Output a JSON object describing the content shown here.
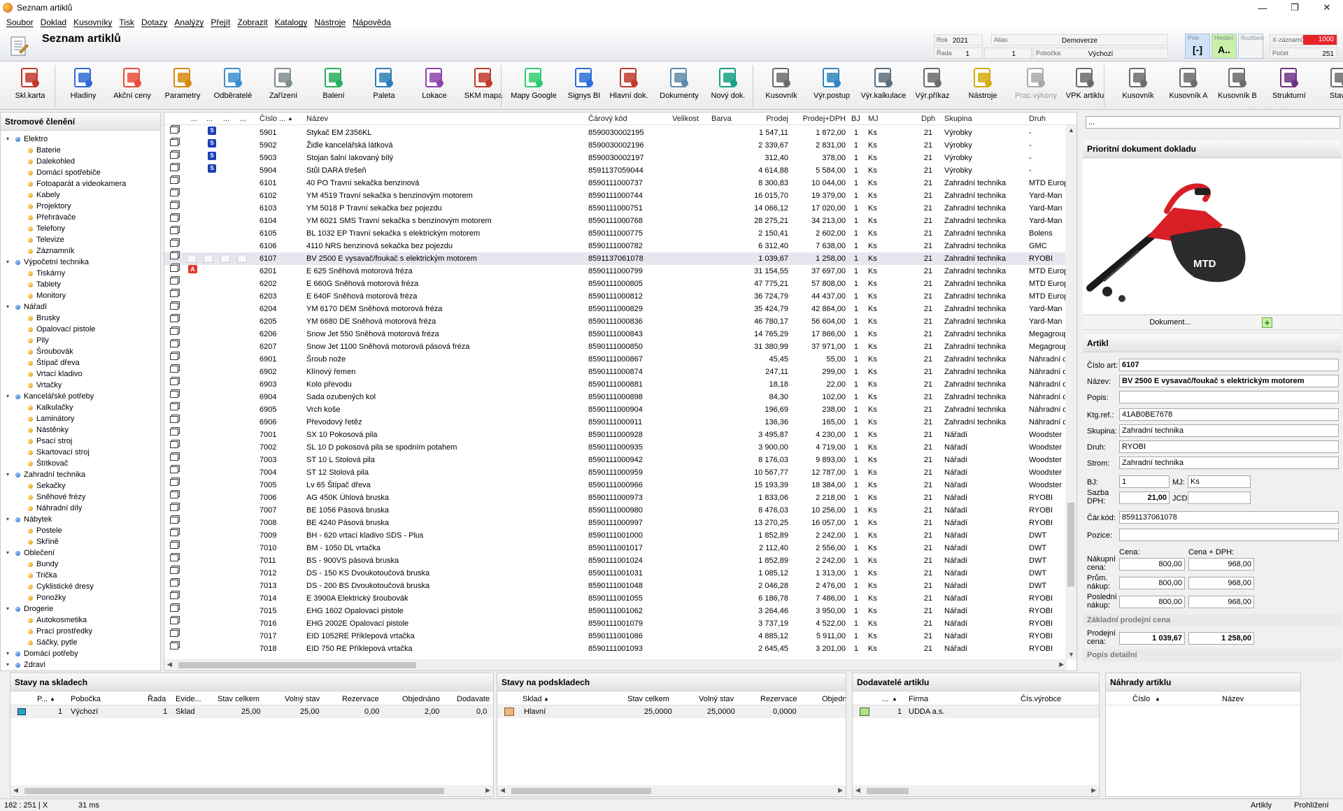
{
  "window": {
    "title": "Seznam artiklů",
    "controls": {
      "minimize": "—",
      "maximize": "❐",
      "close": "✕"
    }
  },
  "menu": [
    "Soubor",
    "Doklad",
    "Kusovníky",
    "Tisk",
    "Dotazy",
    "Analýzy",
    "Přejít",
    "Zobrazit",
    "Katalogy",
    "Nástroje",
    "Nápověda"
  ],
  "header": {
    "page_title": "Seznam artiklů",
    "rok_label": "Rok",
    "rok_value": "2021",
    "alias_label": "Alias",
    "alias_value": "Demoverze",
    "rada_label": "Řada",
    "rada_value": "1",
    "rada_value2": "1",
    "pobocka_label": "Pobočka",
    "pobocka_value": "Výchozí",
    "pole_label": "Pole",
    "pole_value": "[-]",
    "hledani_label": "Hledání",
    "hledani_value": "A..",
    "rozliseni_label": "Rozlišení",
    "xzaznamu_label": "X-záznamů",
    "xzaznamu_value": "1000",
    "pocet_label": "Počet",
    "pocet_value": "251",
    "colors": {
      "xzaznamu_bg": "#e8232a",
      "pole_bg": "#cfe3f8",
      "hledani_bg": "#c9f0a8"
    }
  },
  "toolbar": [
    {
      "label": "Skl.karta",
      "icon": "stock-card-icon"
    },
    {
      "label": "Hladiny",
      "icon": "levels-icon"
    },
    {
      "label": "Akční ceny",
      "icon": "action-price-icon"
    },
    {
      "label": "Parametry",
      "icon": "parameters-icon"
    },
    {
      "label": "Odběratelé",
      "icon": "customers-icon"
    },
    {
      "label": "Zařízení",
      "icon": "devices-icon"
    },
    {
      "label": "Balení",
      "icon": "packaging-icon"
    },
    {
      "label": "Paleta",
      "icon": "pallet-icon"
    },
    {
      "label": "Lokace",
      "icon": "location-icon"
    },
    {
      "label": "SKM mapa",
      "icon": "skm-map-icon"
    },
    {
      "label": "Mapy Google",
      "icon": "google-maps-icon"
    },
    {
      "label": "Signys BI",
      "icon": "signys-bi-icon"
    },
    {
      "label": "Hlavní dok.",
      "icon": "main-document-icon"
    },
    {
      "label": "Dokumenty",
      "icon": "documents-icon"
    },
    {
      "label": "Nový dok.",
      "icon": "new-document-icon"
    },
    {
      "label": "Kusovník",
      "icon": "bom-icon"
    },
    {
      "label": "Výr.postup",
      "icon": "production-process-icon"
    },
    {
      "label": "Výr.kalkulace",
      "icon": "production-calculation-icon"
    },
    {
      "label": "Výr.příkaz",
      "icon": "production-order-icon"
    },
    {
      "label": "Nástroje",
      "icon": "tools-icon"
    },
    {
      "label": "Prac.výkony",
      "icon": "work-performance-icon"
    },
    {
      "label": "VPK artiklu",
      "icon": "vpk-article-icon"
    },
    {
      "label": "Kusovník",
      "icon": "bom-icon"
    },
    {
      "label": "Kusovník A",
      "icon": "bom-a-icon"
    },
    {
      "label": "Kusovník B",
      "icon": "bom-b-icon"
    },
    {
      "label": "Strukturní",
      "icon": "structure-icon"
    },
    {
      "label": "Stave",
      "icon": "state-icon"
    }
  ],
  "tree": {
    "title": "Stromové členění",
    "nodes": [
      {
        "label": "Elektro",
        "level": 0
      },
      {
        "label": "Baterie",
        "level": 1
      },
      {
        "label": "Dalekohled",
        "level": 1
      },
      {
        "label": "Domácí spotřebiče",
        "level": 1
      },
      {
        "label": "Fotoaparát a videokamera",
        "level": 1
      },
      {
        "label": "Kabely",
        "level": 1
      },
      {
        "label": "Projektory",
        "level": 1
      },
      {
        "label": "Přehrávače",
        "level": 1
      },
      {
        "label": "Telefony",
        "level": 1
      },
      {
        "label": "Televize",
        "level": 1
      },
      {
        "label": "Záznamník",
        "level": 1
      },
      {
        "label": "Výpočetní technika",
        "level": 0
      },
      {
        "label": "Tiskárny",
        "level": 1
      },
      {
        "label": "Tablety",
        "level": 1
      },
      {
        "label": "Monitory",
        "level": 1
      },
      {
        "label": "Nářadí",
        "level": 0
      },
      {
        "label": "Brusky",
        "level": 1
      },
      {
        "label": "Opalovací pistole",
        "level": 1
      },
      {
        "label": "Pily",
        "level": 1
      },
      {
        "label": "Šroubovák",
        "level": 1
      },
      {
        "label": "Štípač dřeva",
        "level": 1
      },
      {
        "label": "Vrtací kladivo",
        "level": 1
      },
      {
        "label": "Vrtačky",
        "level": 1
      },
      {
        "label": "Kancelářské potřeby",
        "level": 0
      },
      {
        "label": "Kalkulačky",
        "level": 1
      },
      {
        "label": "Laminátory",
        "level": 1
      },
      {
        "label": "Nástěnky",
        "level": 1
      },
      {
        "label": "Psací stroj",
        "level": 1
      },
      {
        "label": "Skartovací stroj",
        "level": 1
      },
      {
        "label": "Štítkovač",
        "level": 1
      },
      {
        "label": "Zahradní technika",
        "level": 0
      },
      {
        "label": "Sekačky",
        "level": 1
      },
      {
        "label": "Sněhové frézy",
        "level": 1
      },
      {
        "label": "Náhradní díly",
        "level": 1
      },
      {
        "label": "Nábytek",
        "level": 0
      },
      {
        "label": "Postele",
        "level": 1
      },
      {
        "label": "Skříně",
        "level": 1
      },
      {
        "label": "Oblečení",
        "level": 0
      },
      {
        "label": "Bundy",
        "level": 1
      },
      {
        "label": "Trička",
        "level": 1
      },
      {
        "label": "Cyklistické dresy",
        "level": 1
      },
      {
        "label": "Ponožky",
        "level": 1
      },
      {
        "label": "Drogerie",
        "level": 0
      },
      {
        "label": "Autokosmetika",
        "level": 1
      },
      {
        "label": "Prací prostředky",
        "level": 1
      },
      {
        "label": "Sáčky, pytle",
        "level": 1
      },
      {
        "label": "Domácí potřeby",
        "level": 0
      },
      {
        "label": "Zdraví",
        "level": 0
      }
    ]
  },
  "grid": {
    "columns": {
      "c1": "...",
      "c2": "...",
      "c3": "...",
      "c4": "...",
      "cislo": "Číslo ...",
      "nazev": "Název",
      "carovy": "Čárový kód",
      "velikost": "Velikost",
      "barva": "Barva",
      "prodej": "Prodej",
      "prodej_dph": "Prodej+DPH",
      "bj": "BJ",
      "mj": "MJ",
      "dph": "Dph",
      "skupina": "Skupina",
      "druh": "Druh"
    },
    "selected_index": 10,
    "rows": [
      [
        "S",
        "5901",
        "Stykač EM 2356KL",
        "8590030002195",
        "1 547,11",
        "1 872,00",
        "1",
        "Ks",
        "21",
        "Výrobky",
        "-"
      ],
      [
        "S",
        "5902",
        "Židle kancelářská látková",
        "8590030002196",
        "2 339,67",
        "2 831,00",
        "1",
        "Ks",
        "21",
        "Výrobky",
        "-"
      ],
      [
        "S",
        "5903",
        "Stojan šalní lakovaný bílý",
        "8590030002197",
        "312,40",
        "378,00",
        "1",
        "Ks",
        "21",
        "Výrobky",
        "-"
      ],
      [
        "S",
        "5904",
        "Stůl DARA třešeň",
        "8591137059044",
        "4 614,88",
        "5 584,00",
        "1",
        "Ks",
        "21",
        "Výrobky",
        "-"
      ],
      [
        "",
        "6101",
        "40 PO Travní sekačka benzinová",
        "8590111000737",
        "8 300,83",
        "10 044,00",
        "1",
        "Ks",
        "21",
        "Zahradní technika",
        "MTD Europ"
      ],
      [
        "",
        "6102",
        "YM 4519 Travní sekačka s benzinovým motorem",
        "8590111000744",
        "16 015,70",
        "19 379,00",
        "1",
        "Ks",
        "21",
        "Zahradní technika",
        "Yard-Man"
      ],
      [
        "",
        "6103",
        "YM 5018 P Travní sekačka bez pojezdu",
        "8590111000751",
        "14 066,12",
        "17 020,00",
        "1",
        "Ks",
        "21",
        "Zahradní technika",
        "Yard-Man"
      ],
      [
        "",
        "6104",
        "YM 6021 SMS Travní sekačka s benzinovým motorem",
        "8590111000768",
        "28 275,21",
        "34 213,00",
        "1",
        "Ks",
        "21",
        "Zahradní technika",
        "Yard-Man"
      ],
      [
        "",
        "6105",
        "BL 1032 EP Travní sekačka s elektrickým motorem",
        "8590111000775",
        "2 150,41",
        "2 602,00",
        "1",
        "Ks",
        "21",
        "Zahradní technika",
        "Bolens"
      ],
      [
        "",
        "6106",
        "4110 NRS benzinová sekačka bez pojezdu",
        "8590111000782",
        "6 312,40",
        "7 638,00",
        "1",
        "Ks",
        "21",
        "Zahradní technika",
        "GMC"
      ],
      [
        "",
        "6107",
        "BV 2500 E vysavač/foukač s elektrickým motorem",
        "8591137061078",
        "1 039,67",
        "1 258,00",
        "1",
        "Ks",
        "21",
        "Zahradní technika",
        "RYOBI"
      ],
      [
        "A",
        "6201",
        "E 625 Sněhová motorová fréza",
        "8590111000799",
        "31 154,55",
        "37 697,00",
        "1",
        "Ks",
        "21",
        "Zahradní technika",
        "MTD Europ"
      ],
      [
        "",
        "6202",
        "E 660G Sněhová motorová fréza",
        "8590111000805",
        "47 775,21",
        "57 808,00",
        "1",
        "Ks",
        "21",
        "Zahradní technika",
        "MTD Europ"
      ],
      [
        "",
        "6203",
        "E 640F Sněhová motorová fréza",
        "8590111000812",
        "36 724,79",
        "44 437,00",
        "1",
        "Ks",
        "21",
        "Zahradní technika",
        "MTD Europ"
      ],
      [
        "",
        "6204",
        "YM 6170 DEM Sněhová motorová fréza",
        "8590111000829",
        "35 424,79",
        "42 864,00",
        "1",
        "Ks",
        "21",
        "Zahradní technika",
        "Yard-Man"
      ],
      [
        "",
        "6205",
        "YM 6680 DE Sněhová motorová fréza",
        "8590111000836",
        "46 780,17",
        "56 604,00",
        "1",
        "Ks",
        "21",
        "Zahradní technika",
        "Yard-Man"
      ],
      [
        "",
        "6206",
        "Snow Jet 550 Sněhová motorová fréza",
        "8590111000843",
        "14 765,29",
        "17 866,00",
        "1",
        "Ks",
        "21",
        "Zahradní technika",
        "Megagroup"
      ],
      [
        "",
        "6207",
        "Snow Jet 1100 Sněhová motorová pásová fréza",
        "8590111000850",
        "31 380,99",
        "37 971,00",
        "1",
        "Ks",
        "21",
        "Zahradní technika",
        "Megagroup"
      ],
      [
        "",
        "6901",
        "Šroub nože",
        "8590111000867",
        "45,45",
        "55,00",
        "1",
        "Ks",
        "21",
        "Zahradní technika",
        "Náhradní d"
      ],
      [
        "",
        "6902",
        "Klínový řemen",
        "8590111000874",
        "247,11",
        "299,00",
        "1",
        "Ks",
        "21",
        "Zahradní technika",
        "Náhradní d"
      ],
      [
        "",
        "6903",
        "Kolo převodu",
        "8590111000881",
        "18,18",
        "22,00",
        "1",
        "Ks",
        "21",
        "Zahradní technika",
        "Náhradní d"
      ],
      [
        "",
        "6904",
        "Sada ozubených kol",
        "8590111000898",
        "84,30",
        "102,00",
        "1",
        "Ks",
        "21",
        "Zahradní technika",
        "Náhradní d"
      ],
      [
        "",
        "6905",
        "Vrch koše",
        "8590111000904",
        "196,69",
        "238,00",
        "1",
        "Ks",
        "21",
        "Zahradní technika",
        "Náhradní d"
      ],
      [
        "",
        "6906",
        "Převodový řetěz",
        "8590111000911",
        "136,36",
        "165,00",
        "1",
        "Ks",
        "21",
        "Zahradní technika",
        "Náhradní d"
      ],
      [
        "",
        "7001",
        "SX 10 Pokosová pila",
        "8590111000928",
        "3 495,87",
        "4 230,00",
        "1",
        "Ks",
        "21",
        "Nářadí",
        "Woodster"
      ],
      [
        "",
        "7002",
        "SL 10 D pokosová pila se spodním potahem",
        "8590111000935",
        "3 900,00",
        "4 719,00",
        "1",
        "Ks",
        "21",
        "Nářadí",
        "Woodster"
      ],
      [
        "",
        "7003",
        "ST 10 L Stolová pila",
        "8590111000942",
        "8 176,03",
        "9 893,00",
        "1",
        "Ks",
        "21",
        "Nářadí",
        "Woodster"
      ],
      [
        "",
        "7004",
        "ST 12 Stolová pila",
        "8590111000959",
        "10 567,77",
        "12 787,00",
        "1",
        "Ks",
        "21",
        "Nářadí",
        "Woodster"
      ],
      [
        "",
        "7005",
        "Lv 65 Štípač dřeva",
        "8590111000966",
        "15 193,39",
        "18 384,00",
        "1",
        "Ks",
        "21",
        "Nářadí",
        "Woodster"
      ],
      [
        "",
        "7006",
        "AG 450K Úhlová bruska",
        "8590111000973",
        "1 833,06",
        "2 218,00",
        "1",
        "Ks",
        "21",
        "Nářadí",
        "RYOBI"
      ],
      [
        "",
        "7007",
        "BE 1056 Pásová bruska",
        "8590111000980",
        "8 476,03",
        "10 256,00",
        "1",
        "Ks",
        "21",
        "Nářadí",
        "RYOBI"
      ],
      [
        "",
        "7008",
        "BE 4240 Pásová bruska",
        "8590111000997",
        "13 270,25",
        "16 057,00",
        "1",
        "Ks",
        "21",
        "Nářadí",
        "RYOBI"
      ],
      [
        "",
        "7009",
        "BH - 620 vrtací kladivo SDS - Plus",
        "8590111001000",
        "1 852,89",
        "2 242,00",
        "1",
        "Ks",
        "21",
        "Nářadí",
        "DWT"
      ],
      [
        "",
        "7010",
        "BM - 1050 DL vrtačka",
        "8590111001017",
        "2 112,40",
        "2 556,00",
        "1",
        "Ks",
        "21",
        "Nářadí",
        "DWT"
      ],
      [
        "",
        "7011",
        "BS - 900VS pásová bruska",
        "8590111001024",
        "1 852,89",
        "2 242,00",
        "1",
        "Ks",
        "21",
        "Nářadí",
        "DWT"
      ],
      [
        "",
        "7012",
        "DS - 150 KS Dvoukotoučová bruska",
        "8590111001031",
        "1 085,12",
        "1 313,00",
        "1",
        "Ks",
        "21",
        "Nářadí",
        "DWT"
      ],
      [
        "",
        "7013",
        "DS - 200 BS Dvoukotoučová bruska",
        "8590111001048",
        "2 046,28",
        "2 476,00",
        "1",
        "Ks",
        "21",
        "Nářadí",
        "DWT"
      ],
      [
        "",
        "7014",
        "E 3900A Elektrický šroubovák",
        "8590111001055",
        "6 186,78",
        "7 486,00",
        "1",
        "Ks",
        "21",
        "Nářadí",
        "RYOBI"
      ],
      [
        "",
        "7015",
        "EHG 1602 Opalovací pistole",
        "8590111001062",
        "3 264,46",
        "3 950,00",
        "1",
        "Ks",
        "21",
        "Nářadí",
        "RYOBI"
      ],
      [
        "",
        "7016",
        "EHG 2002E Opalovací pistole",
        "8590111001079",
        "3 737,19",
        "4 522,00",
        "1",
        "Ks",
        "21",
        "Nářadí",
        "RYOBI"
      ],
      [
        "",
        "7017",
        "EID 1052RE Příklepová vrtačka",
        "8590111001086",
        "4 885,12",
        "5 911,00",
        "1",
        "Ks",
        "21",
        "Nářadí",
        "RYOBI"
      ],
      [
        "",
        "7018",
        "EID 750 RE Příklepová vrtačka",
        "8590111001093",
        "2 645,45",
        "3 201,00",
        "1",
        "Ks",
        "21",
        "Nářadí",
        "RYOBI"
      ]
    ]
  },
  "right_panel": {
    "search_value": "...",
    "doc_title": "Prioritní dokument dokladu",
    "dokument_button": "Dokument...",
    "add_icon": "plus-icon",
    "image_brand": "MTD",
    "artikl_title": "Artikl",
    "fields": {
      "cislo_label": "Číslo art:",
      "cislo": "6107",
      "nazev_label": "Název:",
      "nazev": "BV 2500 E vysavač/foukač s elektrickým motorem",
      "popis_label": "Popis:",
      "popis": "",
      "ktg_label": "Ktg.ref.:",
      "ktg": "41AB0BE7678",
      "skupina_label": "Skupina:",
      "skupina": "Zahradní technika",
      "druh_label": "Druh:",
      "druh": "RYOBI",
      "strom_label": "Strom:",
      "strom": "Zahradní technika",
      "bj_label": "BJ:",
      "bj": "1",
      "mj_label": "MJ:",
      "mj": "Ks",
      "sazba_label": "Sazba DPH:",
      "sazba": "21,00",
      "jcd_label": "JCD:",
      "jcd": "",
      "car_label": "Čár.kód:",
      "car": "8591137061078",
      "pozice_label": "Pozice:",
      "pozice": "",
      "cena_label": "Cena:",
      "cena_dph_label": "Cena + DPH:",
      "nakupni_label": "Nákupní cena:",
      "nakupni": "800,00",
      "nakupni_dph": "968,00",
      "prum_label": "Prům. nákup:",
      "prum": "800,00",
      "prum_dph": "968,00",
      "posledni_label": "Poslední nákup:",
      "posledni": "800,00",
      "posledni_dph": "968,00",
      "zakladni_title": "Základní prodejní cena",
      "prodejni_label": "Prodejní cena:",
      "prodejni": "1 039,67",
      "prodejni_dph": "1 258,00",
      "popis_detailni": "Popis detailní"
    }
  },
  "bottom": {
    "stavy": {
      "title": "Stavy na skladech",
      "cols": [
        "P...",
        "Pobočka",
        "Řada",
        "Evide...",
        "Stav celkem",
        "Volný stav",
        "Rezervace",
        "Objednáno",
        "Dodavate"
      ],
      "row": [
        "1",
        "Výchozí",
        "1",
        "Sklad",
        "25,00",
        "25,00",
        "0,00",
        "2,00",
        "0,0"
      ]
    },
    "podsklady": {
      "title": "Stavy na podskladech",
      "cols": [
        "Sklad",
        "Stav celkem",
        "Volný stav",
        "Rezervace",
        "Objedn"
      ],
      "row": [
        "Hlavní",
        "25,0000",
        "25,0000",
        "0,0000",
        ""
      ]
    },
    "dodavatele": {
      "title": "Dodavatelé artiklu",
      "cols": [
        "...",
        "Firma",
        "Čís.výrobce"
      ],
      "row": [
        "1",
        "UDDA a.s.",
        ""
      ]
    },
    "nahrady": {
      "title": "Náhrady artiklu",
      "cols": [
        "Číslo",
        "Název"
      ]
    }
  },
  "status": {
    "pos": "182 :   251  | X",
    "time": "31 ms",
    "artikly": "Artikly",
    "mode": "Prohlížení"
  }
}
